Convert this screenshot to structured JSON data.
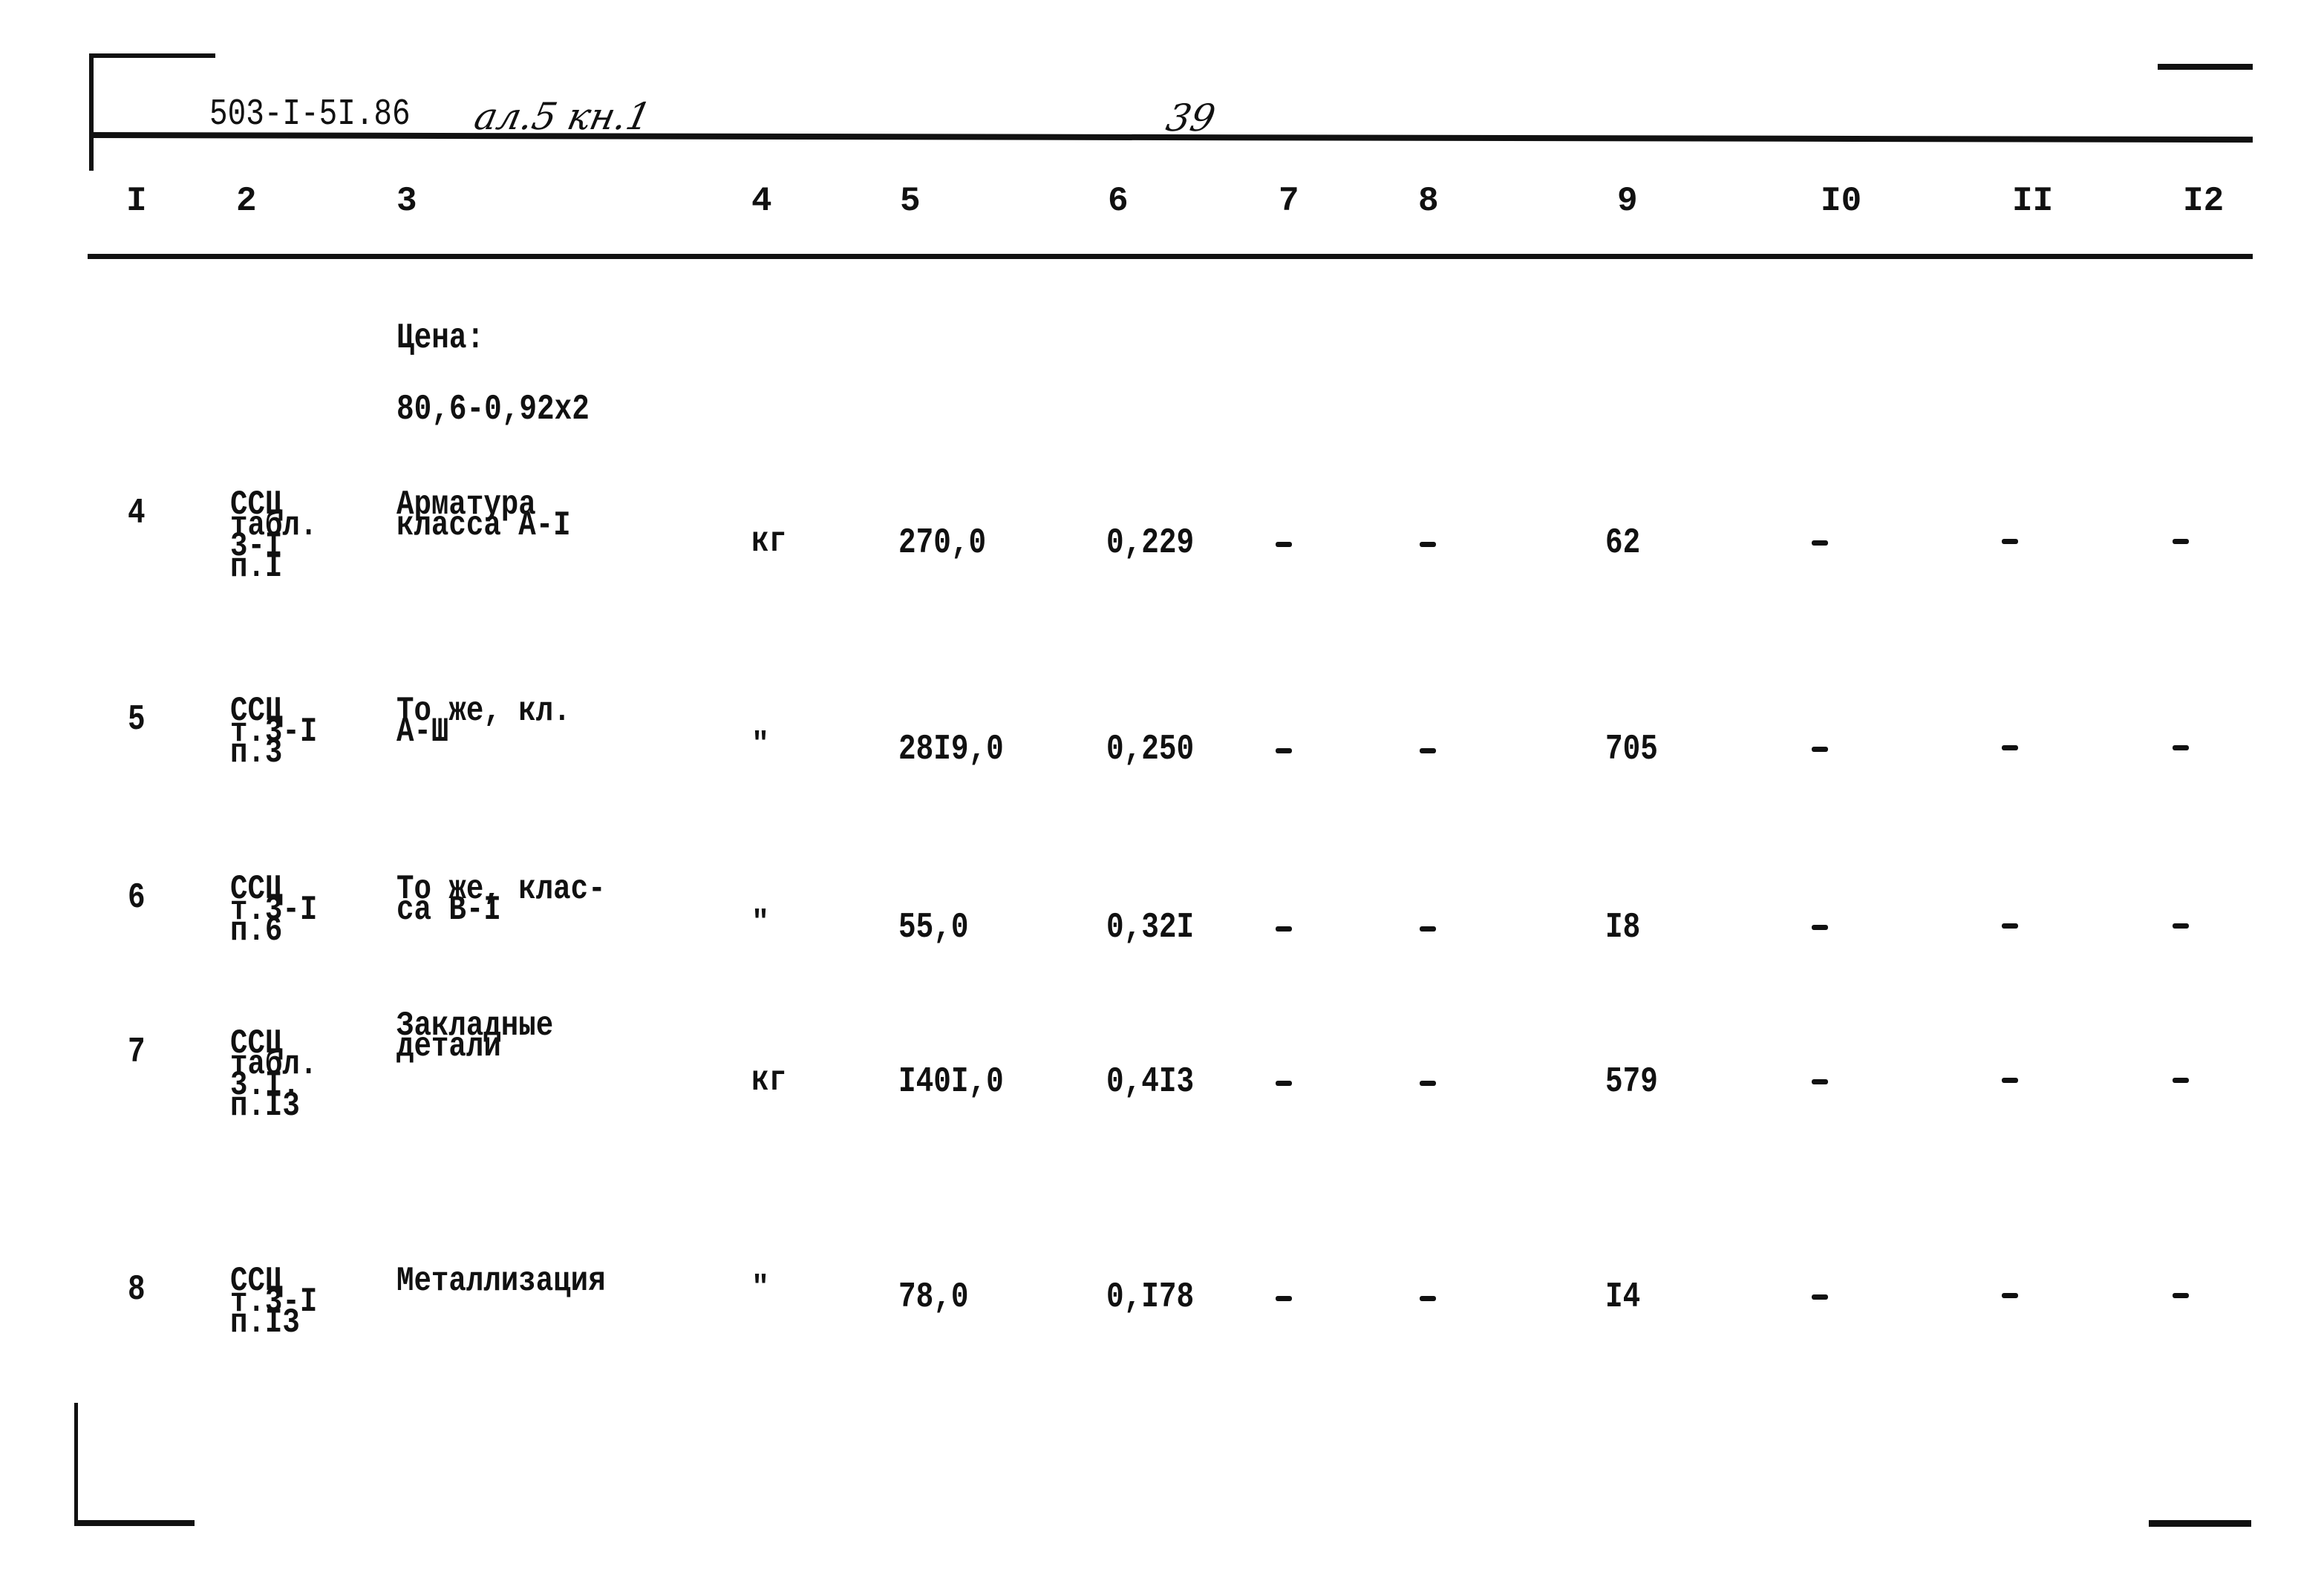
{
  "header": {
    "doc_code": "503-I-5I.86",
    "handwritten_note": "ал.5  кн.1",
    "page_number": "39"
  },
  "columns": [
    "I",
    "2",
    "3",
    "4",
    "5",
    "6",
    "7",
    "8",
    "9",
    "I0",
    "II",
    "I2"
  ],
  "price_note": {
    "label": "Цена:",
    "formula": "80,6-0,92х2"
  },
  "rows": [
    {
      "num": "4",
      "ref": [
        "ССЦ",
        "табл.",
        "3-I",
        "п.I"
      ],
      "name": [
        "Арматура",
        "класса А-I"
      ],
      "unit": "кг",
      "qty": "270,0",
      "price": "0,229",
      "c7": "–",
      "c8": "–",
      "total": "62",
      "c10": "–",
      "c11": "–",
      "c12": "–"
    },
    {
      "num": "5",
      "ref": [
        "ССЦ",
        "т.3-I",
        "п.3"
      ],
      "name": [
        "То же, кл.",
        "А-Ш"
      ],
      "unit": "\"",
      "qty": "28I9,0",
      "price": "0,250",
      "c7": "–",
      "c8": "–",
      "total": "705",
      "c10": "–",
      "c11": "–",
      "c12": "–"
    },
    {
      "num": "6",
      "ref": [
        "ССЦ",
        "т.3-I",
        "п.6"
      ],
      "name": [
        "То же, клас-",
        "са В-I"
      ],
      "unit": "\"",
      "qty": "55,0",
      "price": "0,32I",
      "c7": "–",
      "c8": "–",
      "total": "I8",
      "c10": "–",
      "c11": "–",
      "c12": "–"
    },
    {
      "num": "7",
      "ref": [
        "ССЦ",
        "табл.",
        "3.I.",
        "п.I3"
      ],
      "name": [
        "Закладные",
        "детали"
      ],
      "unit": "кг",
      "qty": "I40I,0",
      "price": "0,4I3",
      "c7": "–",
      "c8": "–",
      "total": "579",
      "c10": "–",
      "c11": "–",
      "c12": "–"
    },
    {
      "num": "8",
      "ref": [
        "ССЦ",
        "т.3-I",
        "п.I3"
      ],
      "name": [
        "Металлизация"
      ],
      "unit": "\"",
      "qty": "78,0",
      "price": "0,I78",
      "c7": "–",
      "c8": "–",
      "total": "I4",
      "c10": "–",
      "c11": "–",
      "c12": "–"
    }
  ]
}
